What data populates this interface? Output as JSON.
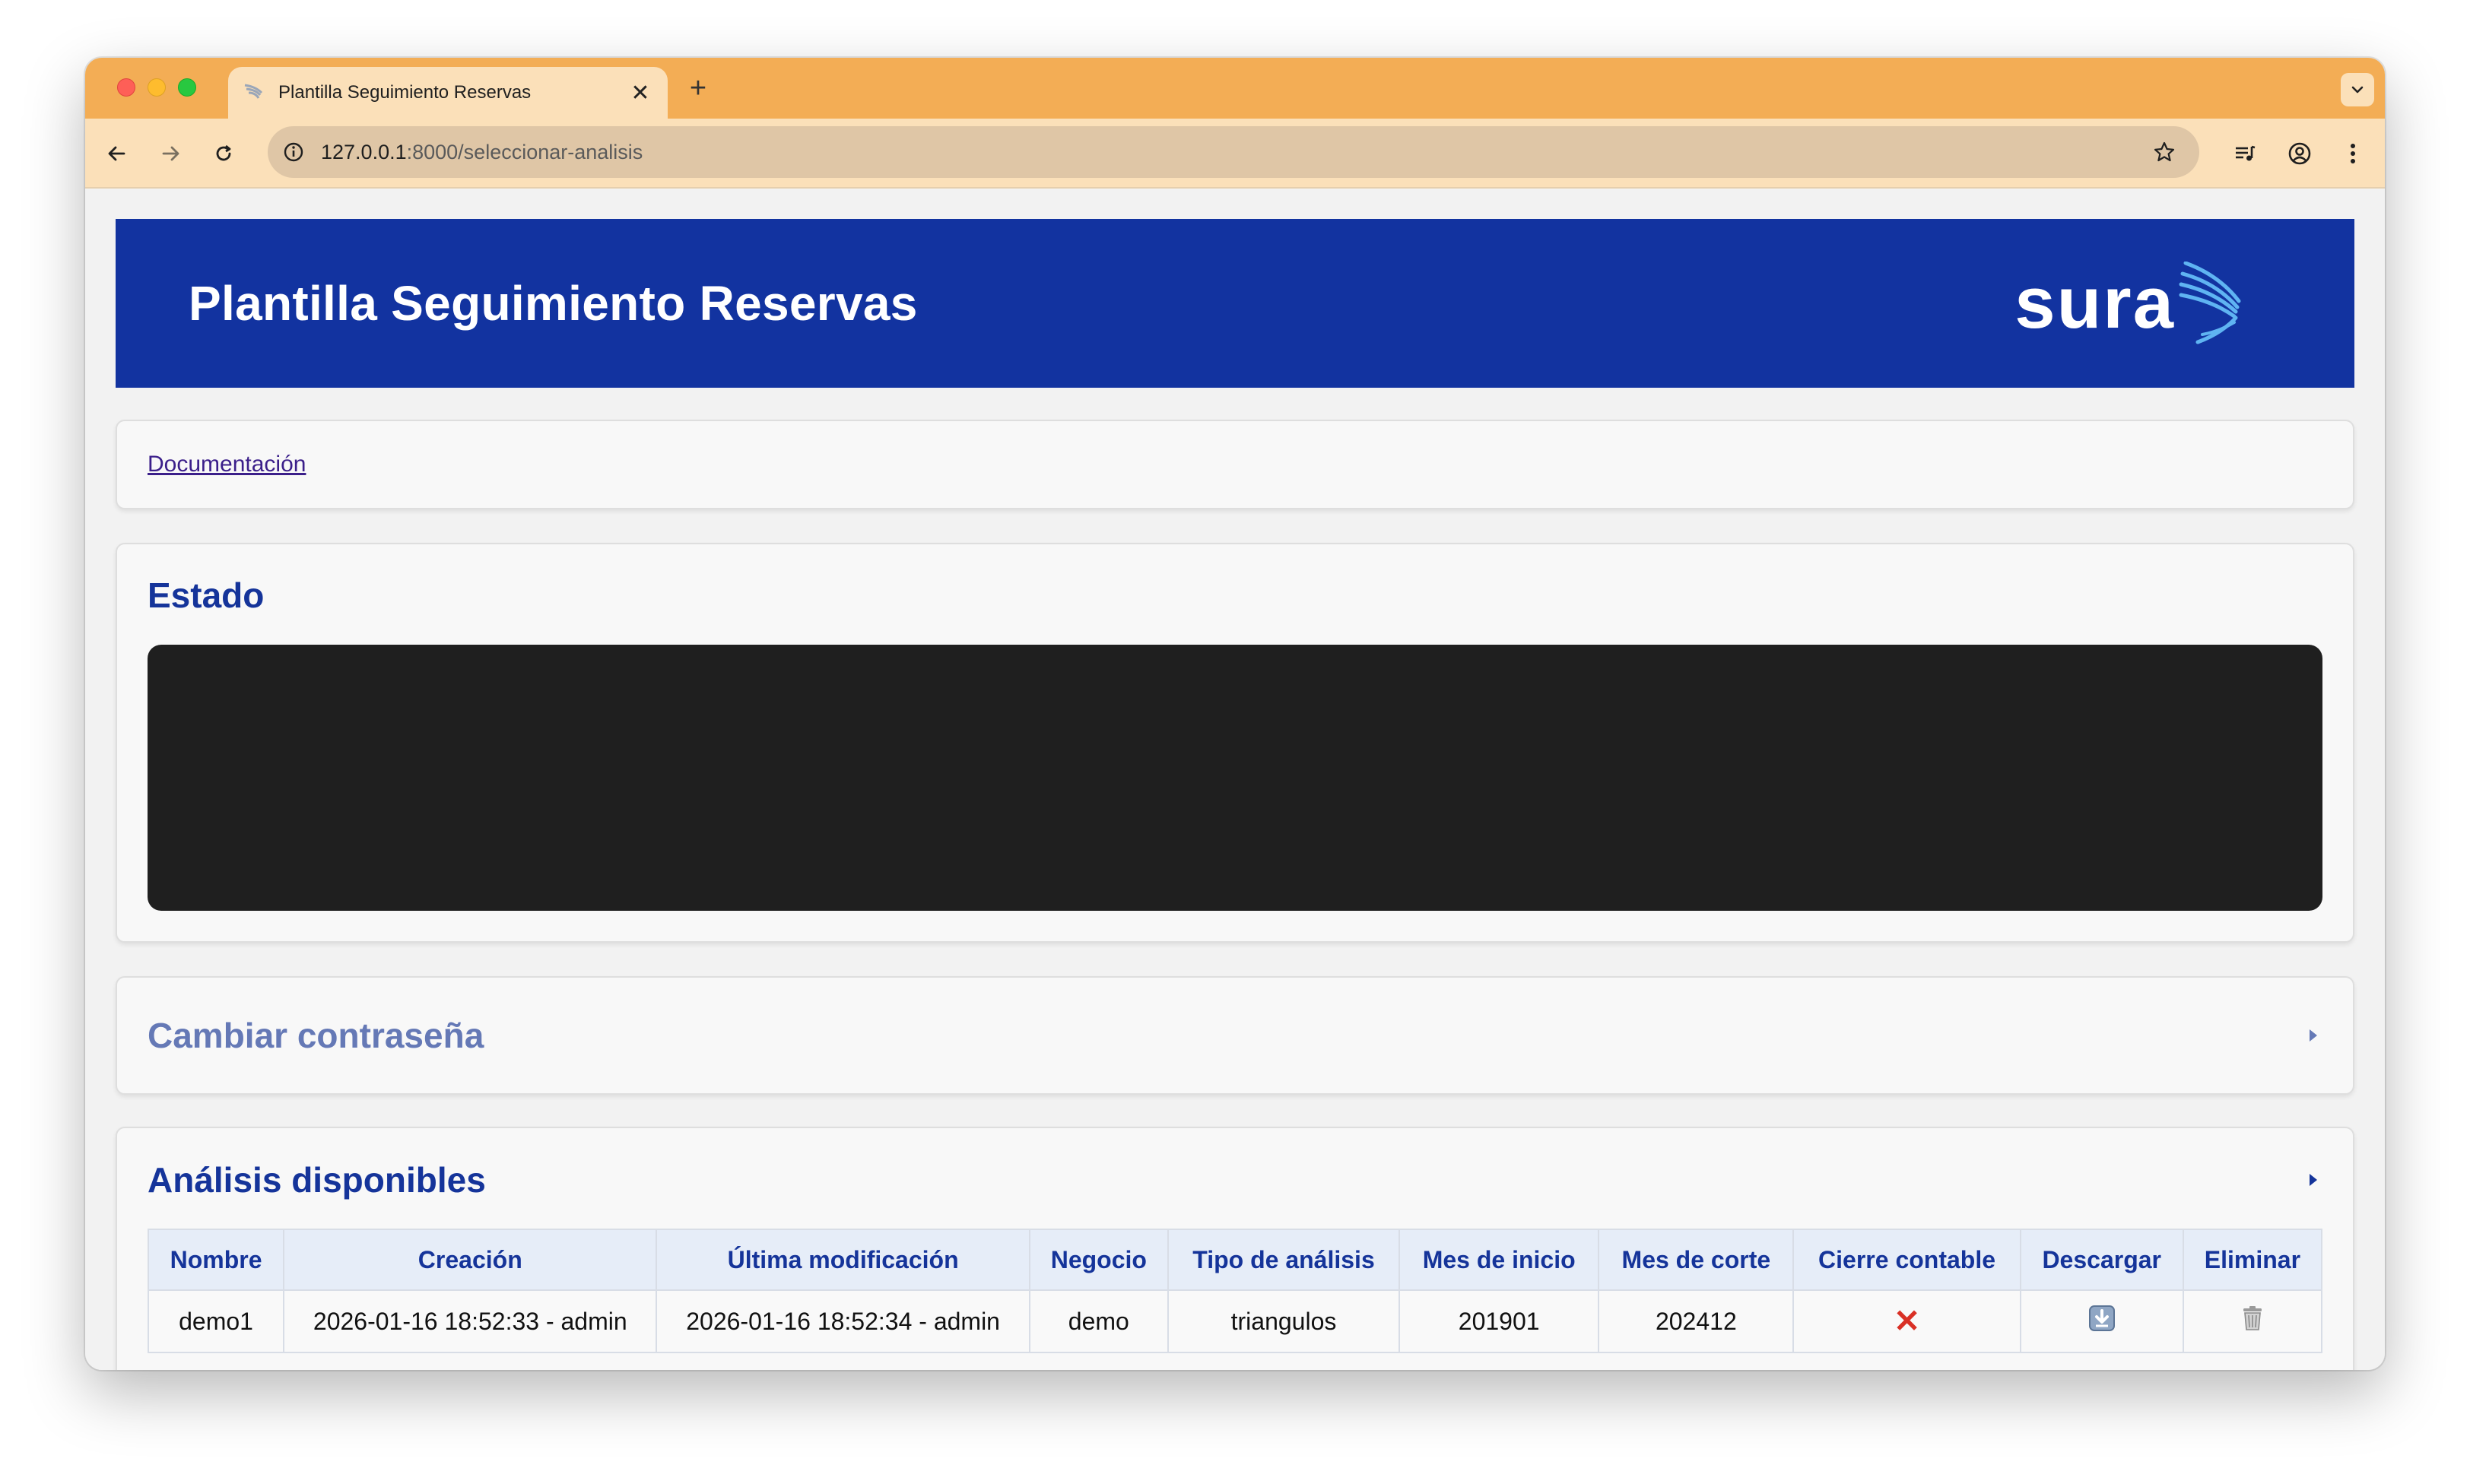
{
  "browser": {
    "tab_title": "Plantilla Seguimiento Reservas",
    "url_host": "127.0.0.1",
    "url_path": ":8000/seleccionar-analisis",
    "icons": {
      "back": "arrow-left-icon",
      "forward": "arrow-right-icon",
      "reload": "reload-icon",
      "info": "info-icon",
      "bookmark": "star-icon",
      "media": "playlist-icon",
      "profile": "profile-icon",
      "menu": "kebab-menu-icon",
      "tab_close": "close-icon",
      "new_tab": "plus-icon",
      "tab_search": "chevron-down-icon"
    }
  },
  "header": {
    "title": "Plantilla Seguimiento Reservas",
    "logo_text": "sura",
    "background_color": "#1233a0"
  },
  "docs": {
    "link_label": "Documentación"
  },
  "estado": {
    "title": "Estado"
  },
  "password": {
    "title": "Cambiar contraseña"
  },
  "analisis": {
    "title": "Análisis disponibles",
    "columns": [
      "Nombre",
      "Creación",
      "Última modificación",
      "Negocio",
      "Tipo de análisis",
      "Mes de inicio",
      "Mes de corte",
      "Cierre contable",
      "Descargar",
      "Eliminar"
    ],
    "rows": [
      {
        "nombre": "demo1",
        "creacion": "2026-01-16 18:52:33 - admin",
        "ultima_modificacion": "2026-01-16 18:52:34 - admin",
        "negocio": "demo",
        "tipo": "triangulos",
        "mes_inicio": "201901",
        "mes_corte": "202412",
        "cierre_contable": "✕",
        "descargar_icon": "download-icon",
        "eliminar_icon": "trash-icon"
      }
    ]
  }
}
